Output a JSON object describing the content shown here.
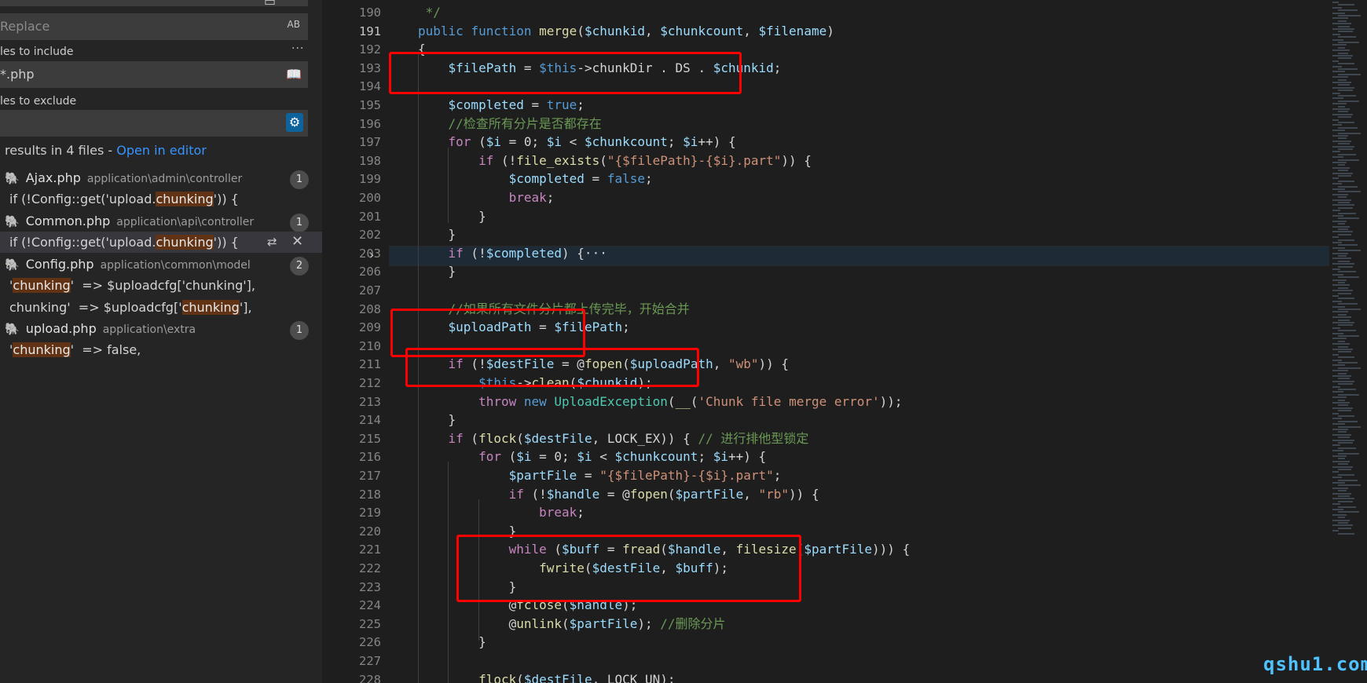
{
  "search": {
    "replace_placeholder": "Replace",
    "preserve_case_label": "AB",
    "more_label": "...",
    "include_label": "les to include",
    "include_value": "*.php",
    "exclude_label": "les to exclude",
    "results_summary": "results in 4 files - ",
    "open_in_editor": "Open in editor"
  },
  "results": [
    {
      "file": "Ajax.php",
      "path": "application\\admin\\controller",
      "count": "1",
      "matches": [
        {
          "pre": "if (!Config::get('upload.",
          "hit": "chunking",
          "post": "')) {"
        }
      ]
    },
    {
      "file": "Common.php",
      "path": "application\\api\\controller",
      "count": "1",
      "matches": [
        {
          "pre": "if (!Config::get('upload.",
          "hit": "chunking",
          "post": "')) {"
        }
      ]
    },
    {
      "file": "Config.php",
      "path": "application\\common\\model",
      "count": "2",
      "matches": [
        {
          "pre": "'",
          "hit": "chunking",
          "post": "'  => $uploadcfg['chunking'],"
        },
        {
          "pre": "chunking'  => $uploadcfg['",
          "hit": "chunking",
          "post": "'],"
        }
      ]
    },
    {
      "file": "upload.php",
      "path": "application\\extra",
      "count": "1",
      "matches": [
        {
          "pre": "'",
          "hit": "chunking",
          "post": "'  => false,"
        }
      ]
    }
  ],
  "line_numbers": [
    "190",
    "191",
    "192",
    "193",
    "194",
    "195",
    "196",
    "197",
    "198",
    "199",
    "200",
    "201",
    "202",
    "203",
    "206",
    "207",
    "208",
    "209",
    "210",
    "211",
    "212",
    "213",
    "214",
    "215",
    "216",
    "217",
    "218",
    "219",
    "220",
    "221",
    "222",
    "223",
    "224",
    "225",
    "226",
    "227",
    "228"
  ],
  "code_lines": [
    " */",
    "public function merge($chunkid, $chunkcount, $filename)",
    "{",
    "    $filePath = $this->chunkDir . DS . $chunkid;",
    "",
    "    $completed = true;",
    "    //检查所有分片是否都存在",
    "    for ($i = 0; $i < $chunkcount; $i++) {",
    "        if (!file_exists(\"{$filePath}-{$i}.part\")) {",
    "            $completed = false;",
    "            break;",
    "        }",
    "    }",
    "    if (!$completed) {···",
    "    }",
    "",
    "    //如果所有文件分片都上传完毕，开始合并",
    "    $uploadPath = $filePath;",
    "",
    "    if (!$destFile = @fopen($uploadPath, \"wb\")) {",
    "        $this->clean($chunkid);",
    "        throw new UploadException(__('Chunk file merge error'));",
    "    }",
    "    if (flock($destFile, LOCK_EX)) { // 进行排他型锁定",
    "        for ($i = 0; $i < $chunkcount; $i++) {",
    "            $partFile = \"{$filePath}-{$i}.part\";",
    "            if (!$handle = @fopen($partFile, \"rb\")) {",
    "                break;",
    "            }",
    "            while ($buff = fread($handle, filesize($partFile))) {",
    "                fwrite($destFile, $buff);",
    "            }",
    "            @fclose($handle);",
    "            @unlink($partFile); //删除分片",
    "        }",
    "",
    "        flock($destFile, LOCK_UN);"
  ],
  "watermark": "qshu1.com",
  "colors": {
    "keyword": "#569cd6",
    "control": "#c586c0",
    "variable": "#9cdcfe",
    "function": "#dcdcaa",
    "string": "#ce9178",
    "comment": "#6a9955",
    "class": "#4ec9b0",
    "highlight_box": "#ff0000"
  },
  "icons": {
    "search_view_icon": "search-editor-icon",
    "book_icon": "book-icon",
    "exclude_settings_icon": "gear-icon",
    "file_icon": "php-elephant-icon",
    "replace_icon": "replace-icon",
    "dismiss_icon": "close-icon",
    "fold_icon": "chevron-right-icon"
  }
}
